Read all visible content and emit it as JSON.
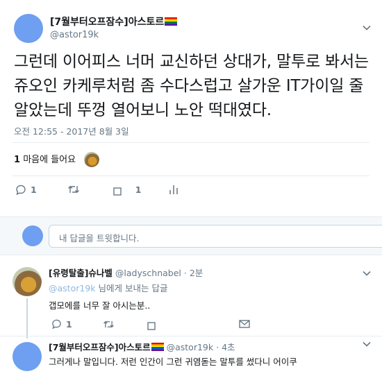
{
  "main_tweet": {
    "display_name": "[7월부터오프잠수]아스토르",
    "handle": "@astor19k",
    "text": "그런데 이어피스 너머 교신하던 상대가, 말투로 봐서는 쥬오인 카케루처럼 좀 수다스럽고 살가운 IT가이일 줄 알았는데 뚜껑 열어보니 노안 떡대였다.",
    "timestamp": "오전 12:55 - 2017년 8월 3일",
    "likes_count": "1",
    "likes_label": "마음에 들어요",
    "reply_count": "1",
    "like_action_count": "1"
  },
  "reply_box": {
    "placeholder": "내 답글을 트윗합니다."
  },
  "replies": [
    {
      "display_name": "[유령탈출]슈나벨",
      "handle": "@ladyschnabel",
      "sep": "·",
      "time": "2분",
      "replying_mention": "@astor19k",
      "replying_suffix": "님에게 보내는 답글",
      "text": "갭모에를 너무 잘 아시는분..",
      "reply_count": "1"
    },
    {
      "display_name": "[7월부터오프잠수]아스토르",
      "handle": "@astor19k",
      "sep": "·",
      "time": "4초",
      "text": "그러게나 말입니다. 저런 인간이 그런 귀염돋는 말투를 썼다니 어이쿠"
    }
  ],
  "colors": {
    "avatar_blue": "#6e9ff0",
    "secondary_text": "#657786",
    "divider": "#e6ecf0"
  },
  "icons": [
    "chevron-down-icon",
    "reply-icon",
    "retweet-icon",
    "like-icon",
    "analytics-icon",
    "direct-message-icon",
    "rainbow-flag-icon"
  ]
}
